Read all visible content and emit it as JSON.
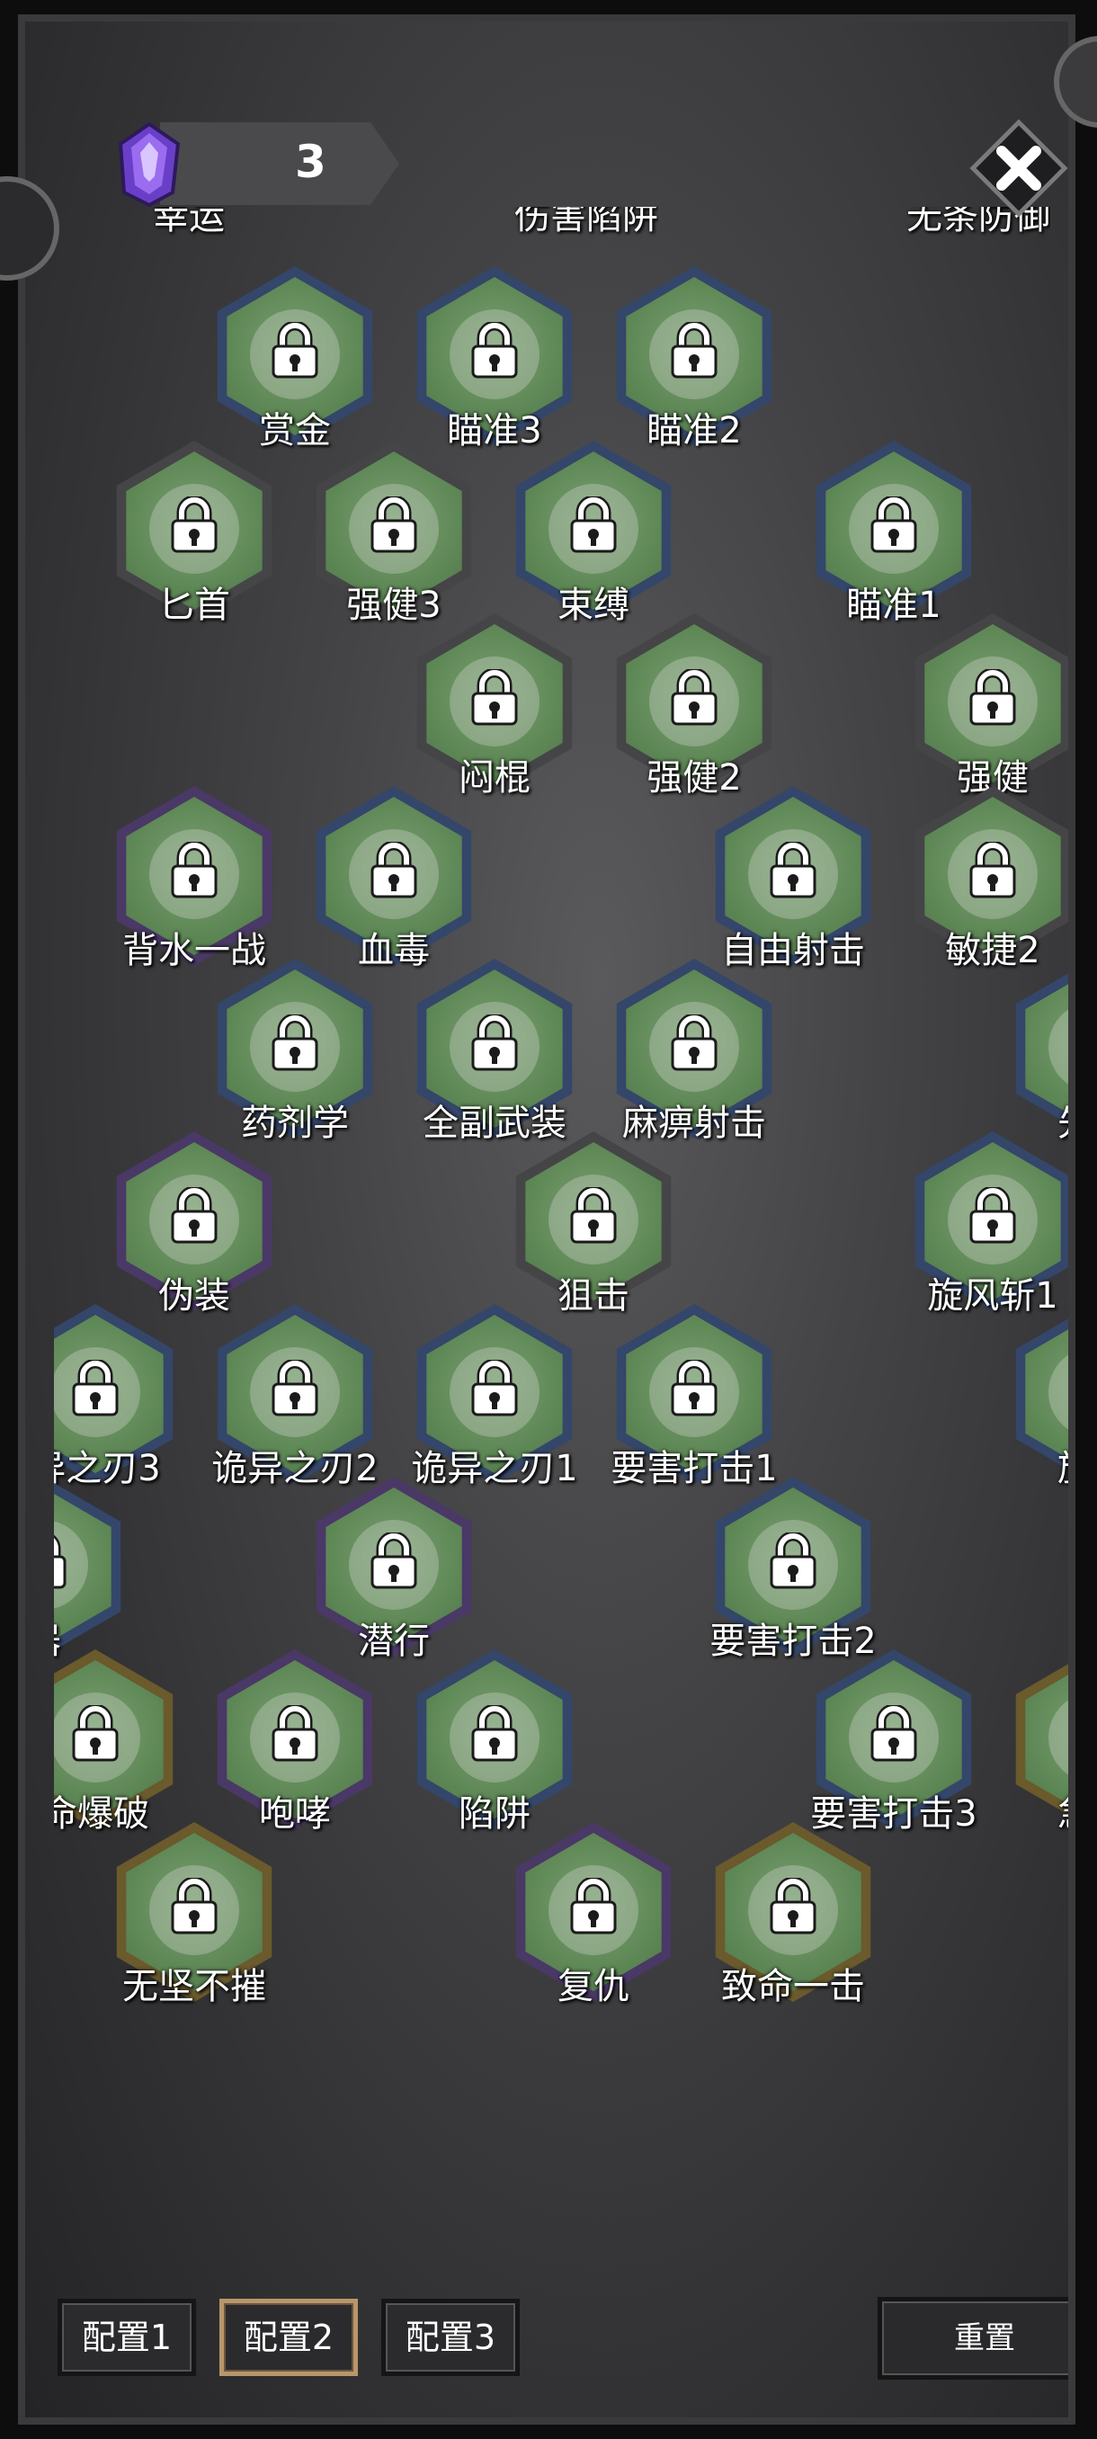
{
  "currency": {
    "icon": "purple-crystal-icon",
    "count": "3"
  },
  "close_icon": "close-icon",
  "top_partial_labels": [
    "幸运",
    "伤害陷阱",
    "无条防御"
  ],
  "skills": [
    {
      "label": "赏金",
      "border": "blue"
    },
    {
      "label": "瞄准3",
      "border": "blue"
    },
    {
      "label": "瞄准2",
      "border": "blue"
    },
    {
      "label": "匕首",
      "border": "gray"
    },
    {
      "label": "强健3",
      "border": "gray"
    },
    {
      "label": "束缚",
      "border": "blue"
    },
    {
      "label": "瞄准1",
      "border": "blue"
    },
    {
      "label": "闷棍",
      "border": "gray"
    },
    {
      "label": "强健2",
      "border": "gray"
    },
    {
      "label": "强健",
      "border": "gray"
    },
    {
      "label": "背水一战",
      "border": "purple"
    },
    {
      "label": "血毒",
      "border": "blue"
    },
    {
      "label": "自由射击",
      "border": "blue"
    },
    {
      "label": "敏捷2",
      "border": "gray"
    },
    {
      "label": "药剂学",
      "border": "blue"
    },
    {
      "label": "全副武装",
      "border": "blue"
    },
    {
      "label": "麻痹射击",
      "border": "blue"
    },
    {
      "label": "先发",
      "border": "blue"
    },
    {
      "label": "伪装",
      "border": "purple"
    },
    {
      "label": "狙击",
      "border": "gray"
    },
    {
      "label": "旋风斩1",
      "border": "blue"
    },
    {
      "label": "异之刃3",
      "border": "blue"
    },
    {
      "label": "诡异之刃2",
      "border": "blue"
    },
    {
      "label": "诡异之刃1",
      "border": "blue"
    },
    {
      "label": "要害打击1",
      "border": "blue"
    },
    {
      "label": "旋风",
      "border": "blue"
    },
    {
      "label": "潜行",
      "border": "purple"
    },
    {
      "label": "要害打击2",
      "border": "blue"
    },
    {
      "label": "命爆破",
      "border": "gold"
    },
    {
      "label": "咆哮",
      "border": "purple"
    },
    {
      "label": "陷阱",
      "border": "blue"
    },
    {
      "label": "要害打击3",
      "border": "blue"
    },
    {
      "label": "急速",
      "border": "gold"
    },
    {
      "label": "无坚不摧",
      "border": "gold"
    },
    {
      "label": "复仇",
      "border": "purple"
    },
    {
      "label": "致命一击",
      "border": "gold"
    },
    {
      "label": "器",
      "border": "blue"
    }
  ],
  "configs": [
    {
      "label": "配置1",
      "active": false
    },
    {
      "label": "配置2",
      "active": true
    },
    {
      "label": "配置3",
      "active": false
    }
  ],
  "reset_label": "重置",
  "colors": {
    "border_blue": "#34466a",
    "border_gray": "#454547",
    "border_purple": "#4a3866",
    "border_gold": "#6a5a2c",
    "node_green": "#5d8655",
    "active_config": "#b9966a"
  }
}
